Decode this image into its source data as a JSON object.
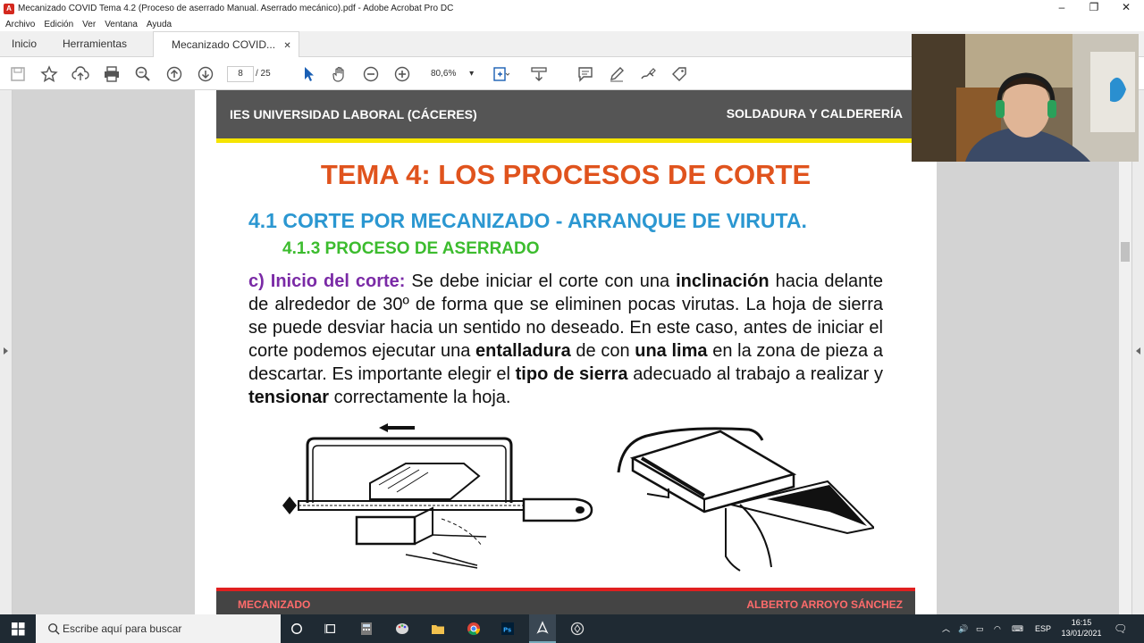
{
  "window": {
    "title": "Mecanizado COVID Tema 4.2 (Proceso de aserrado Manual. Aserrado mecánico).pdf - Adobe Acrobat Pro DC",
    "minimize": "–",
    "restore": "❐",
    "close": "✕"
  },
  "menu": [
    "Archivo",
    "Edición",
    "Ver",
    "Ventana",
    "Ayuda"
  ],
  "tabs": {
    "home": "Inicio",
    "tools": "Herramientas",
    "document": "Mecanizado COVID...",
    "close": "✕"
  },
  "toolbar": {
    "page_current": "8",
    "page_total": "/  25",
    "zoom": "80,6%",
    "zoom_arrow": "▾"
  },
  "page": {
    "header_left": "IES UNIVERSIDAD LABORAL (CÁCERES)",
    "header_right": "SOLDADURA Y CALDERERÍA",
    "title": "TEMA 4: LOS PROCESOS DE CORTE",
    "subtitle": "4.1 CORTE POR MECANIZADO - ARRANQUE DE VIRUTA.",
    "subsubtitle": "4.1.3 PROCESO DE ASERRADO",
    "para": {
      "lead": "c) Inicio del corte:",
      "t1": " Se debe iniciar el corte con una ",
      "b1": "inclinación",
      "t2": " hacia delante de alrededor de 30º de forma que se eliminen pocas virutas. La hoja de sierra se puede desviar hacia un sentido no deseado. En este caso, antes de iniciar el corte podemos ejecutar una ",
      "b2": "entalladura",
      "t3": " de con ",
      "b3": "una lima",
      "t4": " en la zona de pieza a descartar. Es importante elegir el ",
      "b4": "tipo de sierra",
      "t5": " adecuado al trabajo a realizar y ",
      "b5": "tensionar",
      "t6": " correctamente la hoja."
    },
    "footer_left": "MECANIZADO",
    "footer_right": "ALBERTO ARROYO SÁNCHEZ"
  },
  "taskbar": {
    "search_placeholder": "Escribe aquí para buscar",
    "lang": "ESP",
    "time": "16:15",
    "date": "13/01/2021"
  },
  "colors": {
    "title_orange": "#e0531d",
    "subtitle_blue": "#2b97d1",
    "subsub_green": "#3cbc2e",
    "lead_purple": "#7a2aa6",
    "header_gray": "#555555",
    "header_yellow": "#f5e400",
    "footer_red": "#e02020"
  }
}
